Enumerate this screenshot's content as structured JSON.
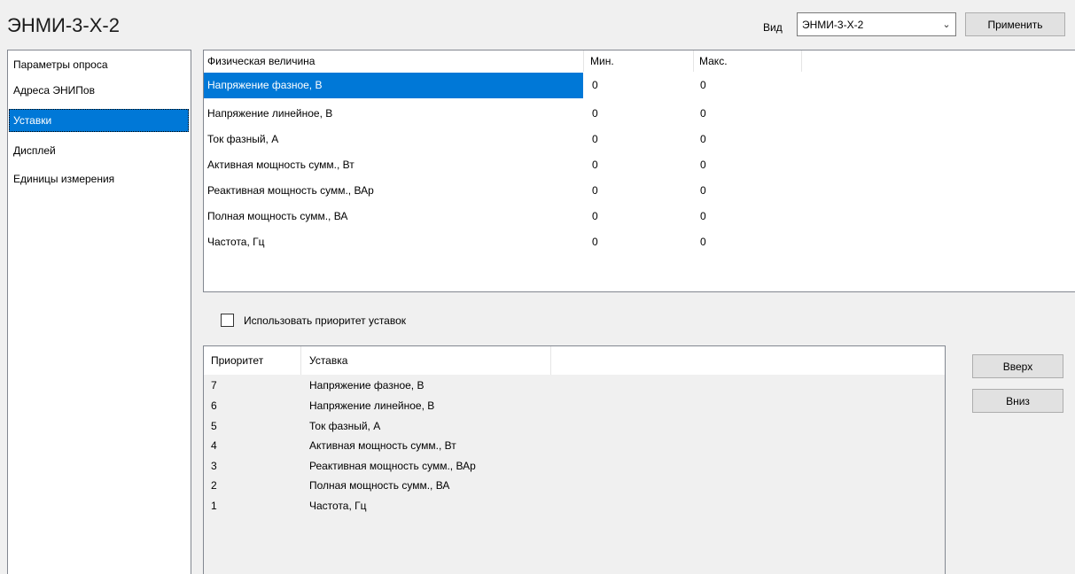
{
  "header": {
    "title": "ЭНМИ-3-Х-2",
    "view_label": "Вид",
    "view_value": "ЭНМИ-3-Х-2",
    "apply_label": "Применить",
    "chevron_icon": "chevron-down-icon"
  },
  "sidebar": {
    "items": [
      {
        "label": "Параметры опроса"
      },
      {
        "label": "Адреса ЭНИПов"
      },
      {
        "label": "Уставки"
      },
      {
        "label": "Дисплей"
      },
      {
        "label": "Единицы измерения"
      }
    ],
    "selected_index": 2
  },
  "physical_table": {
    "columns": [
      "Физическая величина",
      "Мин.",
      "Макс."
    ],
    "rows": [
      {
        "name": "Напряжение фазное, В",
        "min": "0",
        "max": "0"
      },
      {
        "name": "Напряжение линейное, В",
        "min": "0",
        "max": "0"
      },
      {
        "name": "Ток фазный, А",
        "min": "0",
        "max": "0"
      },
      {
        "name": "Активная мощность сумм., Вт",
        "min": "0",
        "max": "0"
      },
      {
        "name": "Реактивная мощность сумм., ВАр",
        "min": "0",
        "max": "0"
      },
      {
        "name": "Полная мощность сумм., ВА",
        "min": "0",
        "max": "0"
      },
      {
        "name": "Частота, Гц",
        "min": "0",
        "max": "0"
      }
    ],
    "selected_index": 0
  },
  "priority_checkbox": {
    "label": "Использовать приоритет уставок",
    "checked": false
  },
  "priority_table": {
    "columns": [
      "Приоритет",
      "Уставка"
    ],
    "rows": [
      {
        "priority": "7",
        "setpoint": "Напряжение фазное, В"
      },
      {
        "priority": "6",
        "setpoint": "Напряжение линейное, В"
      },
      {
        "priority": "5",
        "setpoint": "Ток фазный, А"
      },
      {
        "priority": "4",
        "setpoint": "Активная мощность сумм., Вт"
      },
      {
        "priority": "3",
        "setpoint": "Реактивная мощность сумм., ВАр"
      },
      {
        "priority": "2",
        "setpoint": "Полная мощность сумм., ВА"
      },
      {
        "priority": "1",
        "setpoint": "Частота, Гц"
      }
    ]
  },
  "buttons": {
    "up_label": "Вверх",
    "down_label": "Вниз"
  },
  "colors": {
    "selection": "#0078d7",
    "button_face": "#e1e1e1",
    "window_bg": "#f0f0f0"
  }
}
